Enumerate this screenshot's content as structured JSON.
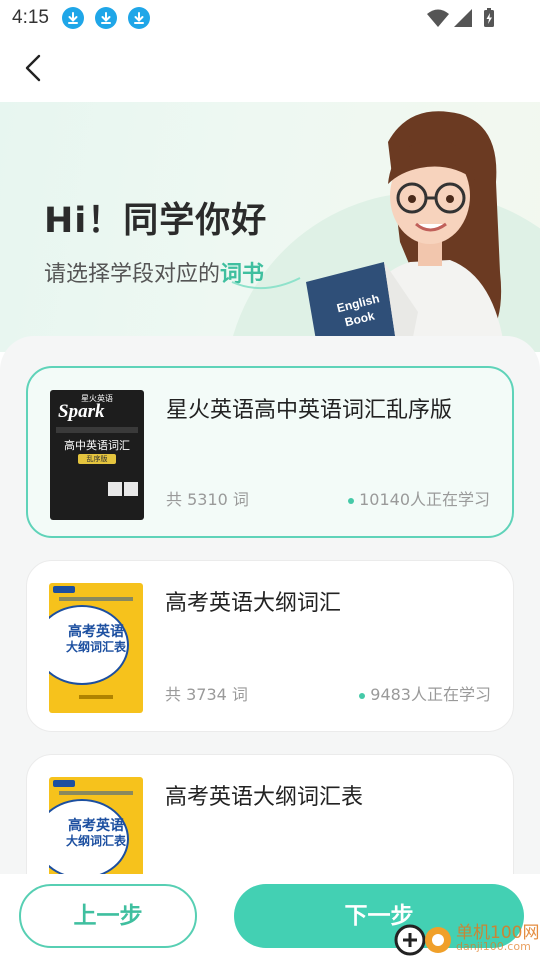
{
  "status_bar": {
    "time": "4:15",
    "notification_icons": [
      "download-icon",
      "download-icon",
      "download-icon"
    ],
    "system_icons": [
      "wifi-icon",
      "signal-icon",
      "battery-icon"
    ]
  },
  "nav": {
    "back_icon": "chevron-left-icon"
  },
  "hero": {
    "greeting": "Hi！同学你好",
    "subtitle_prefix": "请选择学段对应的",
    "subtitle_highlight": "词书",
    "book_text": "English Book"
  },
  "books": [
    {
      "title": "星火英语高中英语词汇乱序版",
      "word_count": "共 5310 词",
      "learners": "10140人正在学习",
      "selected": true,
      "cover": {
        "style": "spark",
        "top_text": "星火英语",
        "logo": "Spark",
        "main": "高中英语词汇",
        "tag": "乱序版"
      }
    },
    {
      "title": "高考英语大纲词汇",
      "word_count": "共 3734 词",
      "learners": "9483人正在学习",
      "selected": false,
      "cover": {
        "style": "yellow",
        "line1": "高考英语",
        "line2": "大纲词汇表"
      }
    },
    {
      "title": "高考英语大纲词汇表",
      "selected": false,
      "cover": {
        "style": "yellow",
        "line1": "高考英语",
        "line2": "大纲词汇表"
      }
    }
  ],
  "actions": {
    "prev_label": "上一步",
    "next_label": "下一步"
  },
  "watermark": {
    "text": "单机100网",
    "sub": "danji100.com"
  },
  "colors": {
    "accent": "#43d0b3",
    "accent_text": "#3fbf9f",
    "download_badge": "#1fa6e8",
    "cover_yellow": "#f6c21c",
    "cover_blue": "#1c4fa0"
  }
}
